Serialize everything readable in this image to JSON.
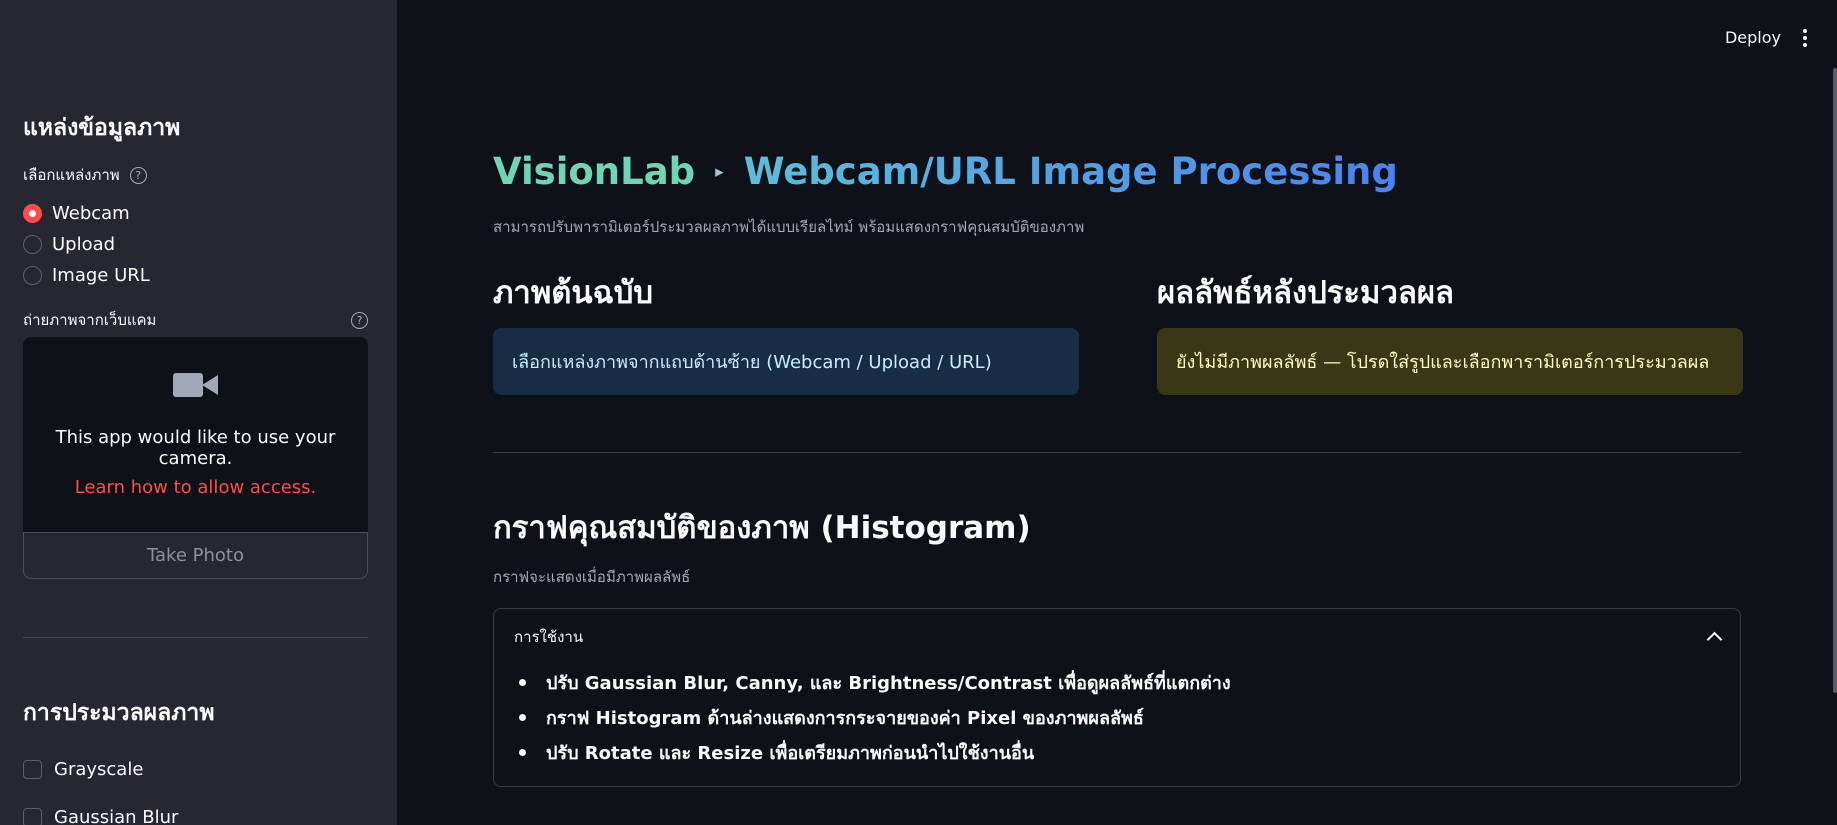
{
  "sidebar": {
    "source_heading": "แหล่งข้อมูลภาพ",
    "source_label": "เลือกแหล่งภาพ",
    "radio_options": [
      "Webcam",
      "Upload",
      "Image URL"
    ],
    "selected_option": "Webcam",
    "camera_label": "ถ่ายภาพจากเว็บแคม",
    "camera_message": "This app would like to use your camera.",
    "camera_link": "Learn how to allow access.",
    "take_photo_label": "Take Photo",
    "processing_heading": "การประมวลผลภาพ",
    "checkboxes": [
      "Grayscale",
      "Gaussian Blur"
    ],
    "help_glyph": "?"
  },
  "toolbar": {
    "deploy_label": "Deploy"
  },
  "main": {
    "title_brand": "VisionLab",
    "title_arrow": "▸",
    "title_page": "Webcam/URL Image Processing",
    "subtitle": "สามารถปรับพารามิเตอร์ประมวลผลภาพได้แบบเรียลไทม์ พร้อมแสดงกราฟคุณสมบัติของภาพ",
    "original_heading": "ภาพต้นฉบับ",
    "original_info": "เลือกแหล่งภาพจากแถบด้านซ้าย (Webcam / Upload / URL)",
    "result_heading": "ผลลัพธ์หลังประมวลผล",
    "result_warning": "ยังไม่มีภาพผลลัพธ์ — โปรดใส่รูปและเลือกพารามิเตอร์การประมวลผล",
    "histogram_heading": "กราฟคุณสมบัติของภาพ (Histogram)",
    "histogram_caption": "กราฟจะแสดงเมื่อมีภาพผลลัพธ์",
    "expander_label": "การใช้งาน",
    "usage_items": [
      "ปรับ Gaussian Blur, Canny, และ Brightness/Contrast เพื่อดูผลลัพธ์ที่แตกต่าง",
      "กราฟ Histogram ด้านล่างแสดงการกระจายของค่า Pixel ของภาพผลลัพธ์",
      "ปรับ Rotate และ Resize เพื่อเตรียมภาพก่อนนำไปใช้งานอื่น"
    ]
  },
  "colors": {
    "accent": "#ff4b4b",
    "sidebar_bg": "#262730",
    "main_bg": "#0e1117",
    "info_bg": "#172d43",
    "warning_bg": "#3a3716"
  }
}
